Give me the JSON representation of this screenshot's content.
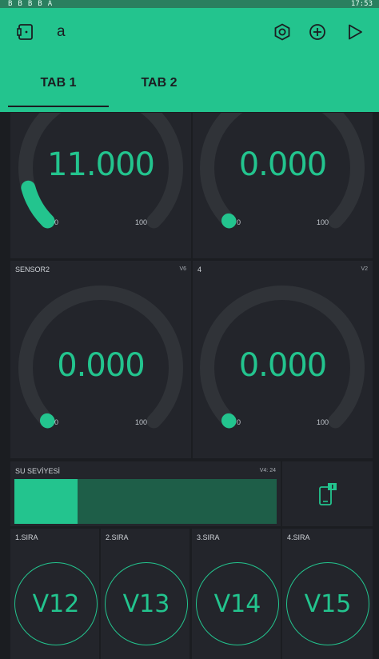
{
  "status_bar": {
    "time": "17:53",
    "notification_icons": [
      "B",
      "B",
      "B",
      "B",
      "A"
    ]
  },
  "header": {
    "title": "a",
    "icons": [
      "device-icon",
      "settings-hex-icon",
      "add-icon",
      "play-icon"
    ],
    "tabs": [
      {
        "label": "TAB 1",
        "active": true
      },
      {
        "label": "TAB 2",
        "active": false
      }
    ]
  },
  "gauges": [
    {
      "label": "",
      "pin": "",
      "value": "11.000",
      "value_num": 11,
      "min": "0",
      "max": "100"
    },
    {
      "label": "",
      "pin": "",
      "value": "0.000",
      "value_num": 0,
      "min": "0",
      "max": "100"
    },
    {
      "label": "SENSOR2",
      "pin": "V6",
      "value": "0.000",
      "value_num": 0,
      "min": "0",
      "max": "100"
    },
    {
      "label": "4",
      "pin": "V2",
      "value": "0.000",
      "value_num": 0,
      "min": "0",
      "max": "100"
    }
  ],
  "level": {
    "label": "SU SEVİYESİ",
    "pin_value": "V4: 24",
    "fill_percent": 24
  },
  "notify_widget": {
    "icon": "phone-notification-icon"
  },
  "buttons": [
    {
      "label": "1.SIRA",
      "pin": "V12"
    },
    {
      "label": "2.SIRA",
      "pin": "V13"
    },
    {
      "label": "3.SIRA",
      "pin": "V14"
    },
    {
      "label": "4.SIRA",
      "pin": "V15"
    }
  ],
  "colors": {
    "accent": "#23c48e",
    "background": "#1b1d21",
    "panel": "#23252b",
    "gauge_track": "#303338",
    "level_track": "#1e5e48"
  }
}
